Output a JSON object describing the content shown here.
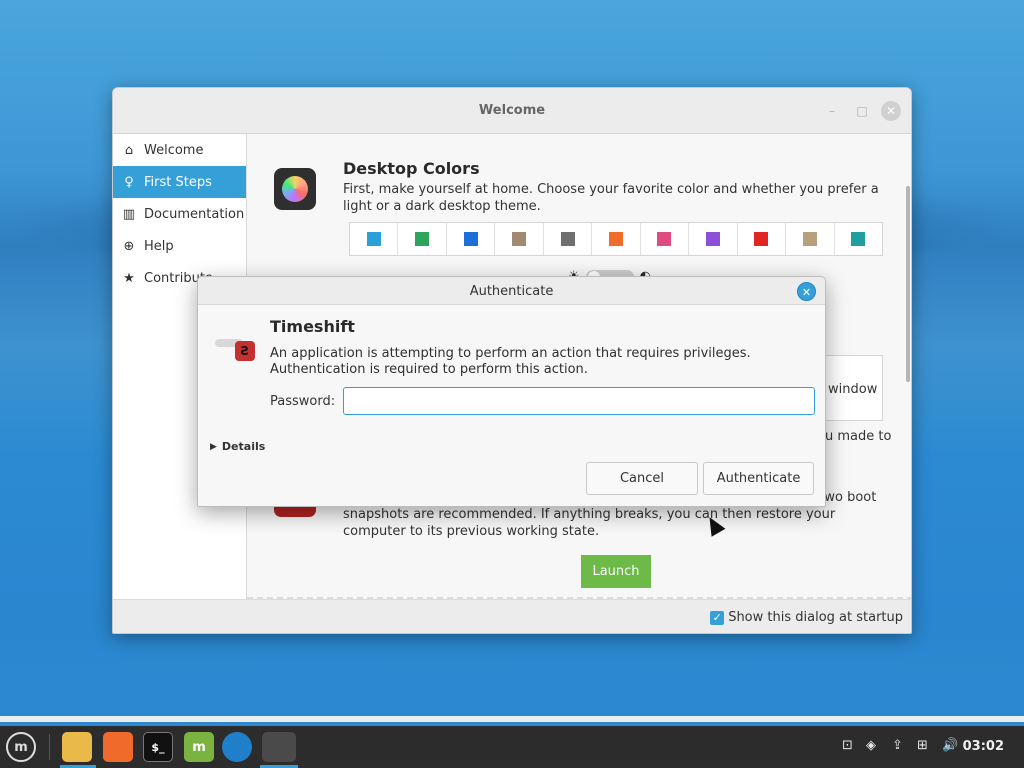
{
  "welcome_window": {
    "title": "Welcome",
    "minimize": "–",
    "maximize": "□",
    "close": "✕",
    "sidebar": [
      {
        "label": "Welcome",
        "icon": "home-icon",
        "glyph": "⌂"
      },
      {
        "label": "First Steps",
        "icon": "lightbulb-icon",
        "glyph": "♀"
      },
      {
        "label": "Documentation",
        "icon": "book-icon",
        "glyph": "▥"
      },
      {
        "label": "Help",
        "icon": "lifebuoy-icon",
        "glyph": "⊕"
      },
      {
        "label": "Contribute",
        "icon": "star-icon",
        "glyph": "★"
      }
    ],
    "section_colors": {
      "title": "Desktop Colors",
      "text": "First, make yourself at home. Choose your favorite color and whether you prefer a light or a dark desktop theme.",
      "swatches": [
        "#2a9fd8",
        "#2da55a",
        "#1b6fd6",
        "#a08a74",
        "#6f6f6f",
        "#ef6c2a",
        "#e04a82",
        "#8d4fd8",
        "#e02525",
        "#b8a07c",
        "#1f9f9f"
      ],
      "light_glyph": "☀",
      "dark_glyph": "◐"
    },
    "layout_label": "window",
    "changes_text": "u made to",
    "section_snapshots": {
      "icon_glyph": "Ƨ",
      "text": "Next, let's set automatic system snapshots. A minimum of two daily and two boot snapshots are recommended. If anything breaks, you can then restore your computer to its previous working state.",
      "launch_label": "Launch"
    },
    "footer": {
      "checkbox_mark": "✓",
      "show_startup_label": "Show this dialog at startup"
    }
  },
  "auth_dialog": {
    "title": "Authenticate",
    "close": "✕",
    "heading": "Timeshift",
    "badge_glyph": "Ƨ",
    "message": "An application is attempting to perform an action that requires privileges. Authentication is required to perform this action.",
    "password_label": "Password:",
    "password_value": "",
    "details_arrow": "▶",
    "details_label": "Details",
    "cancel_label": "Cancel",
    "authenticate_label": "Authenticate"
  },
  "taskbar": {
    "menu_glyph": "m",
    "terminal_glyph": "$_",
    "mint_glyph": "m",
    "clock": "03:02",
    "tray_glyphs": {
      "notes": "⊡",
      "shield": "◈",
      "update": "⇪",
      "network": "⊞",
      "volume": "🔊"
    }
  }
}
